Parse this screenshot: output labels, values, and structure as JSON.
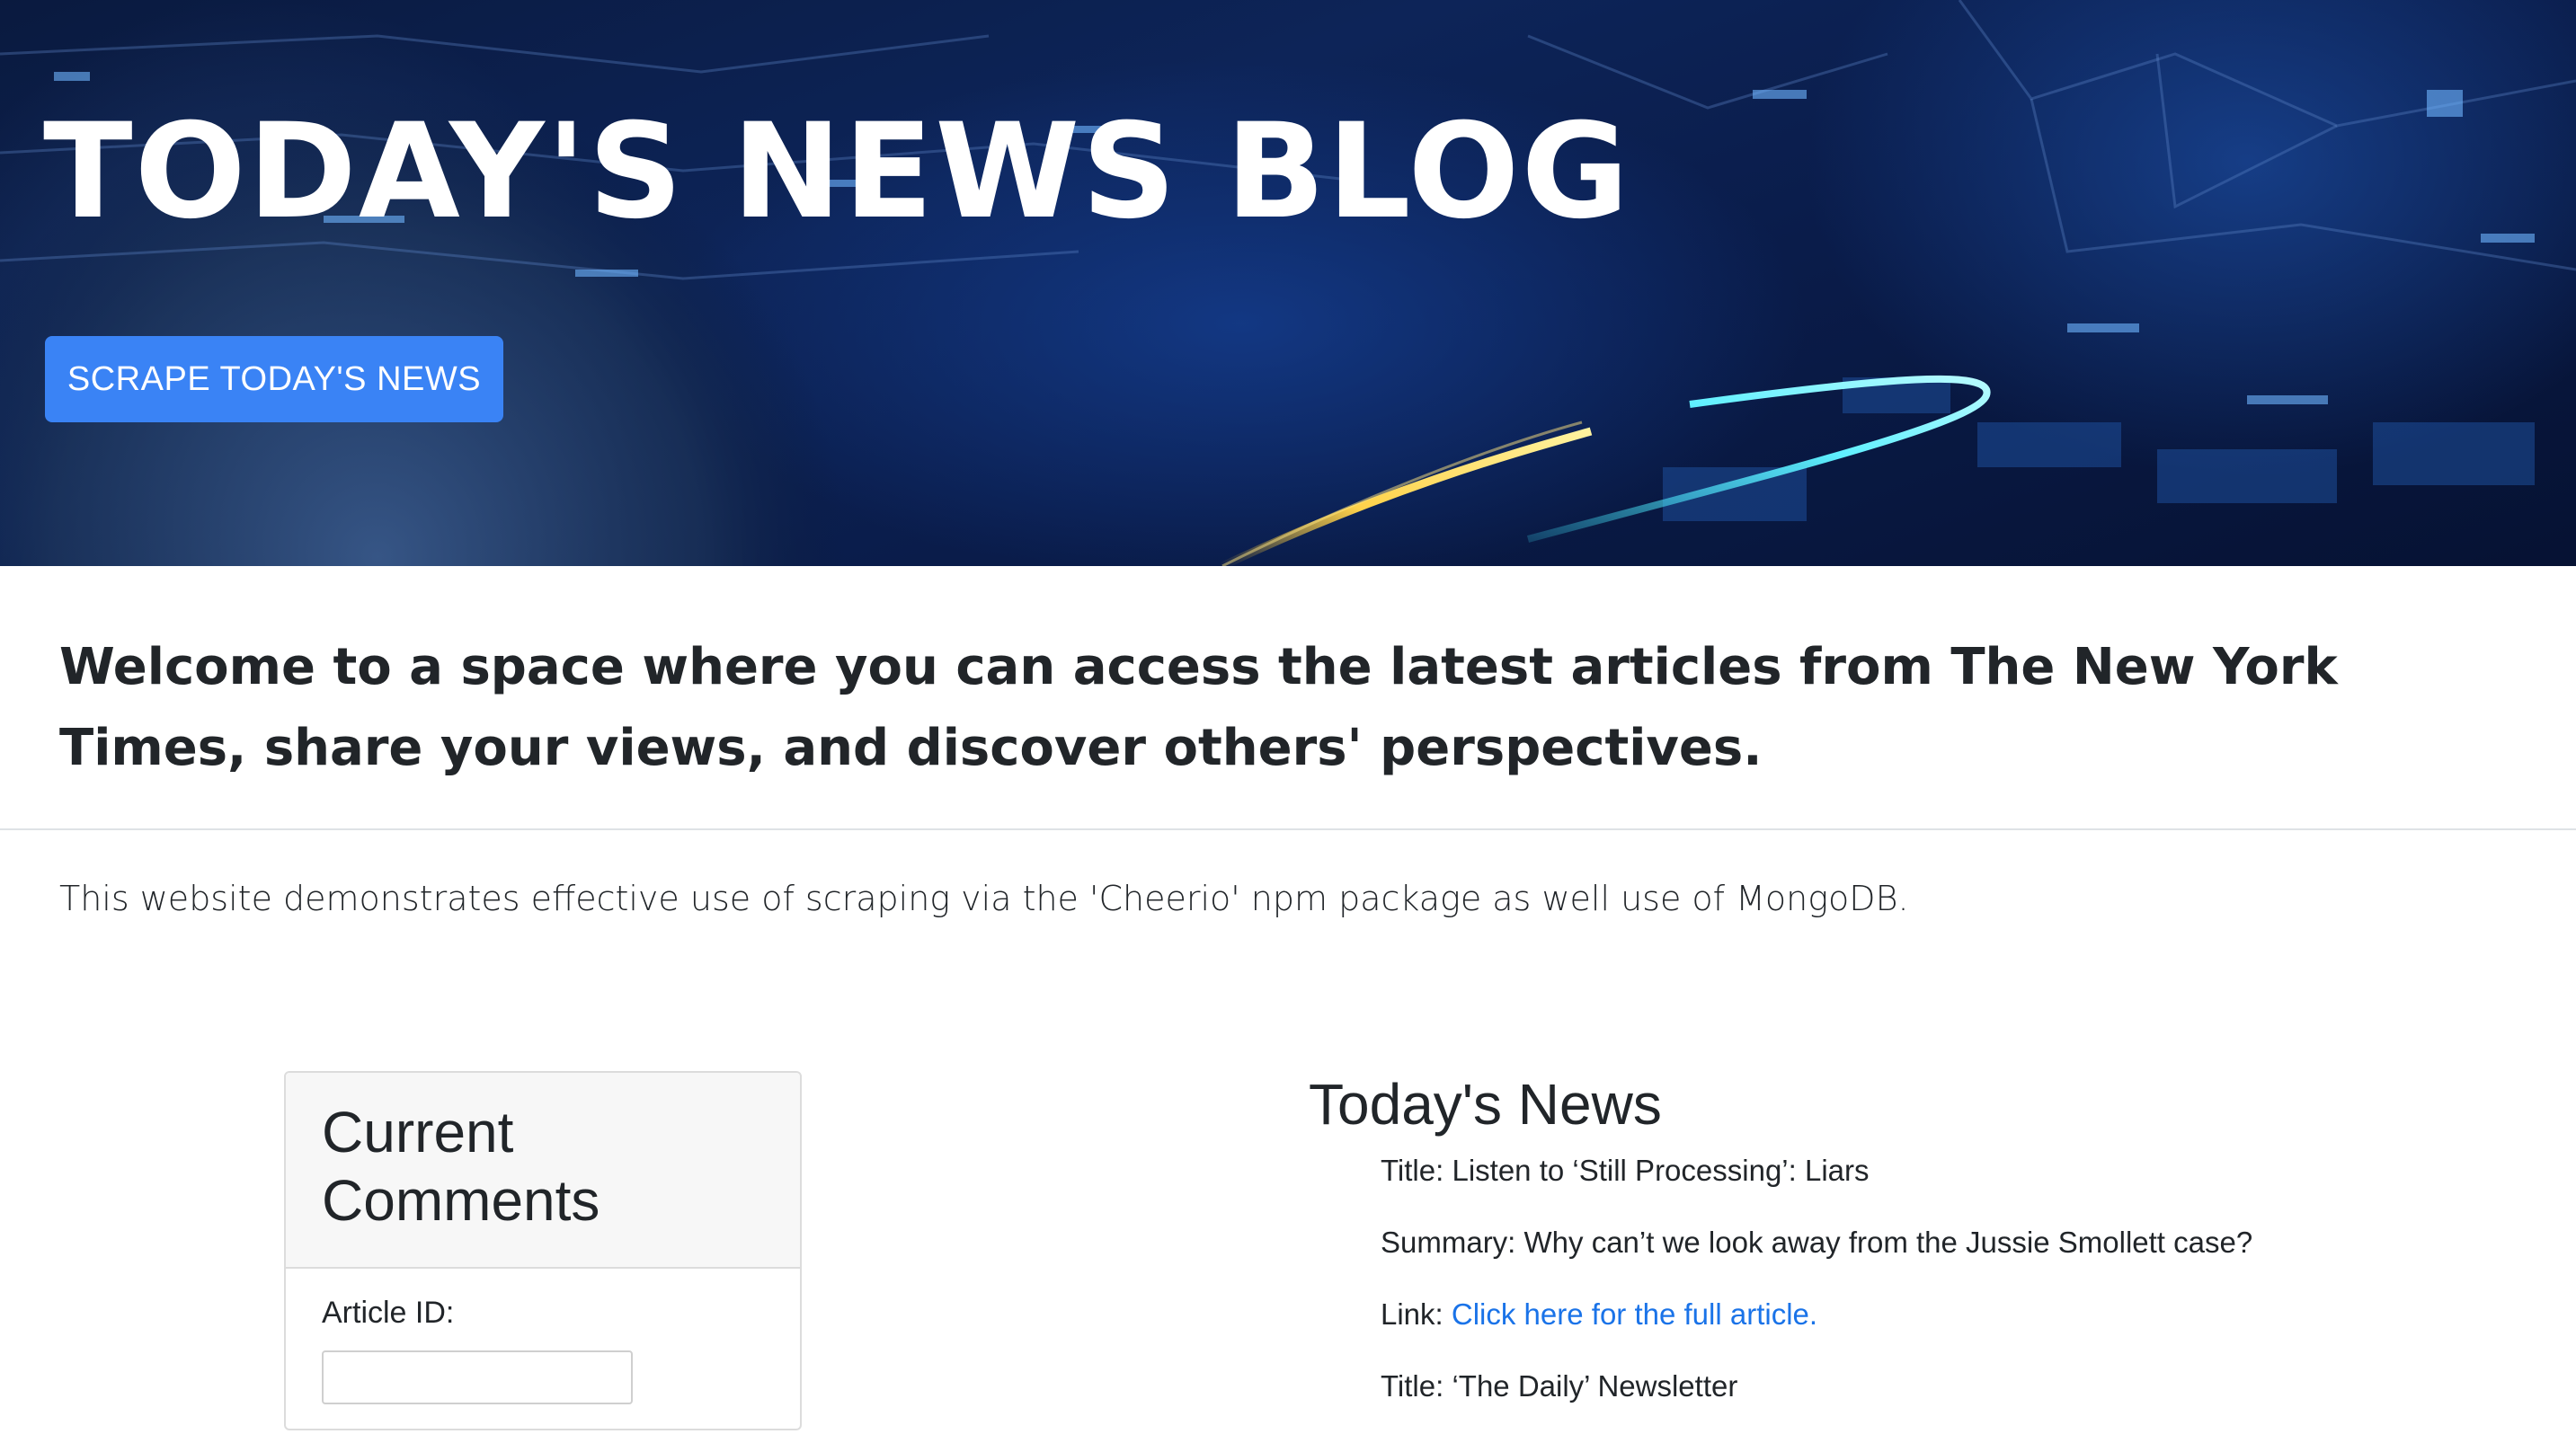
{
  "hero": {
    "title": "TODAY'S NEWS BLOG",
    "scrape_button": "SCRAPE TODAY'S NEWS"
  },
  "intro": {
    "welcome": "Welcome to a space where you can access the latest articles from The New York Times, share your views, and discover others' perspectives.",
    "description": "This website demonstrates effective use of scraping via the 'Cheerio' npm package as well use of MongoDB."
  },
  "comments_card": {
    "title": "Current Comments",
    "article_id_label": "Article ID:",
    "article_id_value": ""
  },
  "news": {
    "heading": "Today's News",
    "articles": [
      {
        "title_label": "Title:",
        "title": "Listen to ‘Still Processing’: Liars",
        "summary_label": "Summary:",
        "summary": "Why can’t we look away from the Jussie Smollett case?",
        "link_label": "Link:",
        "link_text": "Click here for the full article."
      },
      {
        "title_label": "Title:",
        "title": "‘The Daily’ Newsletter"
      }
    ]
  },
  "colors": {
    "accent_button": "#3a83f5",
    "link": "#1a73e8",
    "hero_background": "#0d2458"
  }
}
